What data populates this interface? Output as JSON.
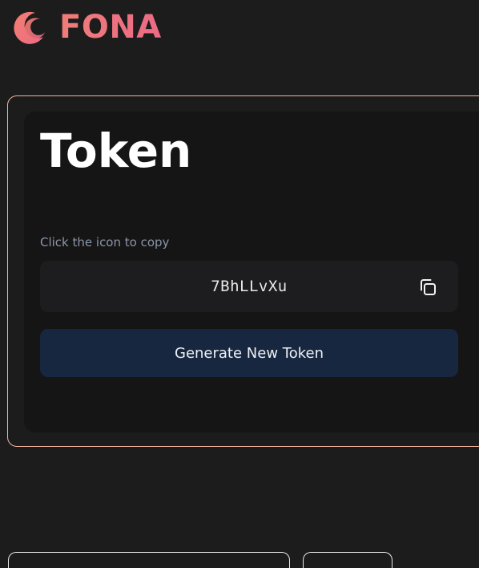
{
  "header": {
    "brand": "FONA",
    "logo_icon": "crescent-logo-icon"
  },
  "card": {
    "title": "Token",
    "hint": "Click the icon to copy",
    "token_value": "7BhLLvXu",
    "copy_icon": "copy-icon",
    "generate_label": "Generate New Token"
  },
  "colors": {
    "background": "#1c1c1d",
    "card_background": "#151515",
    "card_border": "#f0b49a",
    "brand_gradient_start": "#f07d78",
    "brand_gradient_end": "#ec6a86",
    "button_background": "#182740",
    "hint_text": "#8a96a8"
  }
}
